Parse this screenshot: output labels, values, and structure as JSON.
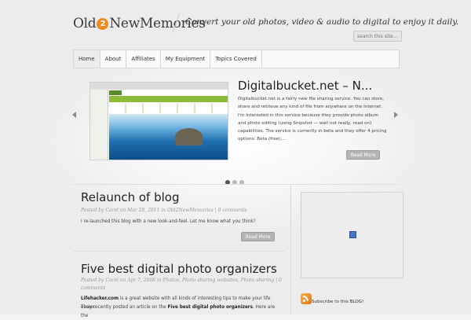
{
  "header": {
    "logo_left": "Old",
    "logo_badge": "2",
    "logo_right": "NewMemories",
    "tagline": "Convert your old photos, video & audio to digital to enjoy it daily.",
    "search_placeholder": "search this site..."
  },
  "nav": {
    "items": [
      {
        "label": "Home"
      },
      {
        "label": "About"
      },
      {
        "label": "Affiliates"
      },
      {
        "label": "My Equipment"
      },
      {
        "label": "Topics Covered"
      }
    ]
  },
  "slider": {
    "title": "Digitalbucket.net – N...",
    "body": "Digitalbucket.net is a fairly new file sharing service. You can store, share and retrieve any kind of file from anywhere on the Internet. I'm interested in this service because they provide photo album and photo editing (using Snipshot — well not really, read on) capabilities. The service is currently in beta and they offer 4 pricing options: Beta (free),...",
    "read_more": "Read More",
    "thumb_logo": "ozfilz"
  },
  "posts": [
    {
      "title": "Relaunch of blog",
      "meta": "Posted by Carel on Mar 28, 2011 in Old2NewMemories | 0 comments",
      "text": "I re-launched this blog with a new look-and-feel. Let me know what you think?",
      "read_more": "Read More"
    },
    {
      "title": "Five best digital photo organizers",
      "meta_line1": "Posted by Carel on Apr 7, 2008 in Photos, Photo sharing websites, Photo sharing | 0",
      "meta_line2": "comments",
      "text_strong1": "Lifehacker.com",
      "text_part1": " is a great website with all kinds of interesting tips to make your life easier.",
      "text_part2": "They recently posted an article on the ",
      "text_strong2": "Five best digital photo organizers",
      "text_part3": ". Here are the"
    }
  ],
  "sidebar": {
    "subscribe": "Subscribe to this BLOG!"
  }
}
